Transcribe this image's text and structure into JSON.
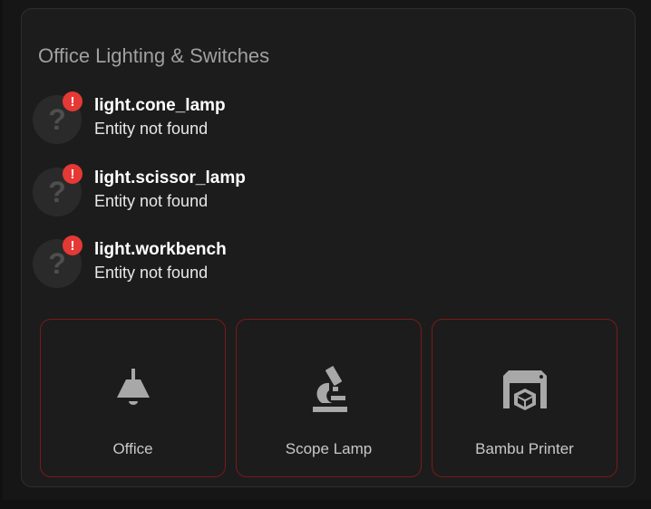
{
  "card": {
    "title": "Office Lighting & Switches"
  },
  "entities": [
    {
      "name": "light.cone_lamp",
      "state": "Entity not found",
      "icon": "question-icon",
      "badge": "!"
    },
    {
      "name": "light.scissor_lamp",
      "state": "Entity not found",
      "icon": "question-icon",
      "badge": "!"
    },
    {
      "name": "light.workbench",
      "state": "Entity not found",
      "icon": "question-icon",
      "badge": "!"
    }
  ],
  "buttons": [
    {
      "label": "Office",
      "icon": "ceiling-lamp-icon"
    },
    {
      "label": "Scope Lamp",
      "icon": "microscope-icon"
    },
    {
      "label": "Bambu Printer",
      "icon": "3d-printer-icon"
    }
  ],
  "colors": {
    "error_badge": "#e53935",
    "button_border": "#7a1a1a",
    "icon_gray": "#a8a8a8"
  }
}
